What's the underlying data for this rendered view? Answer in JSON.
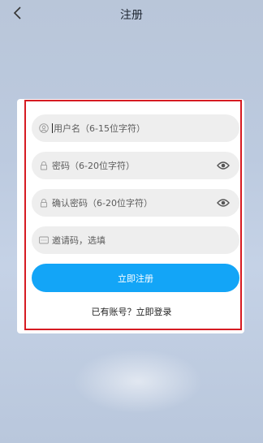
{
  "header": {
    "title": "注册",
    "back_icon": "chevron-left-icon"
  },
  "form": {
    "username_placeholder": "用户名（6-15位字符）",
    "password_placeholder": "密码（6-20位字符）",
    "confirm_placeholder": "确认密码（6-20位字符）",
    "invite_placeholder": "邀请码，选填",
    "icons": [
      "user-icon",
      "lock-icon",
      "lock-icon",
      "invite-code-icon",
      "eye-icon"
    ]
  },
  "actions": {
    "register_label": "立即注册",
    "login_link": "已有账号？立即登录"
  },
  "colors": {
    "accent": "#13a5f7",
    "highlight_border": "#d61b22"
  }
}
